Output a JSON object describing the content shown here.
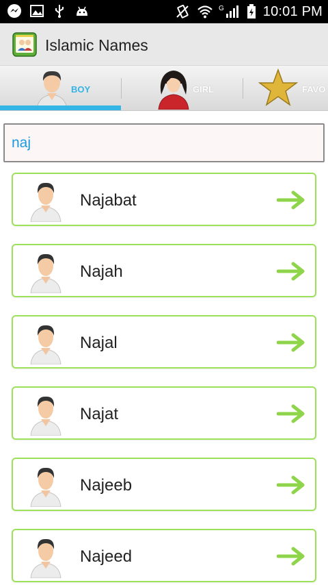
{
  "status_bar": {
    "time": "10:01 PM",
    "network": "G"
  },
  "app": {
    "title": "Islamic Names"
  },
  "tabs": [
    {
      "label": "BOY",
      "selected": true
    },
    {
      "label": "GIRL",
      "selected": false
    },
    {
      "label": "FAVO",
      "selected": false
    }
  ],
  "search": {
    "value": "naj"
  },
  "names": [
    {
      "name": "Najabat"
    },
    {
      "name": "Najah"
    },
    {
      "name": "Najal"
    },
    {
      "name": "Najat"
    },
    {
      "name": "Najeeb"
    },
    {
      "name": "Najeed"
    }
  ],
  "colors": {
    "accent": "#33b5e5",
    "card_border": "#9be25a",
    "arrow": "#8ed54a"
  }
}
